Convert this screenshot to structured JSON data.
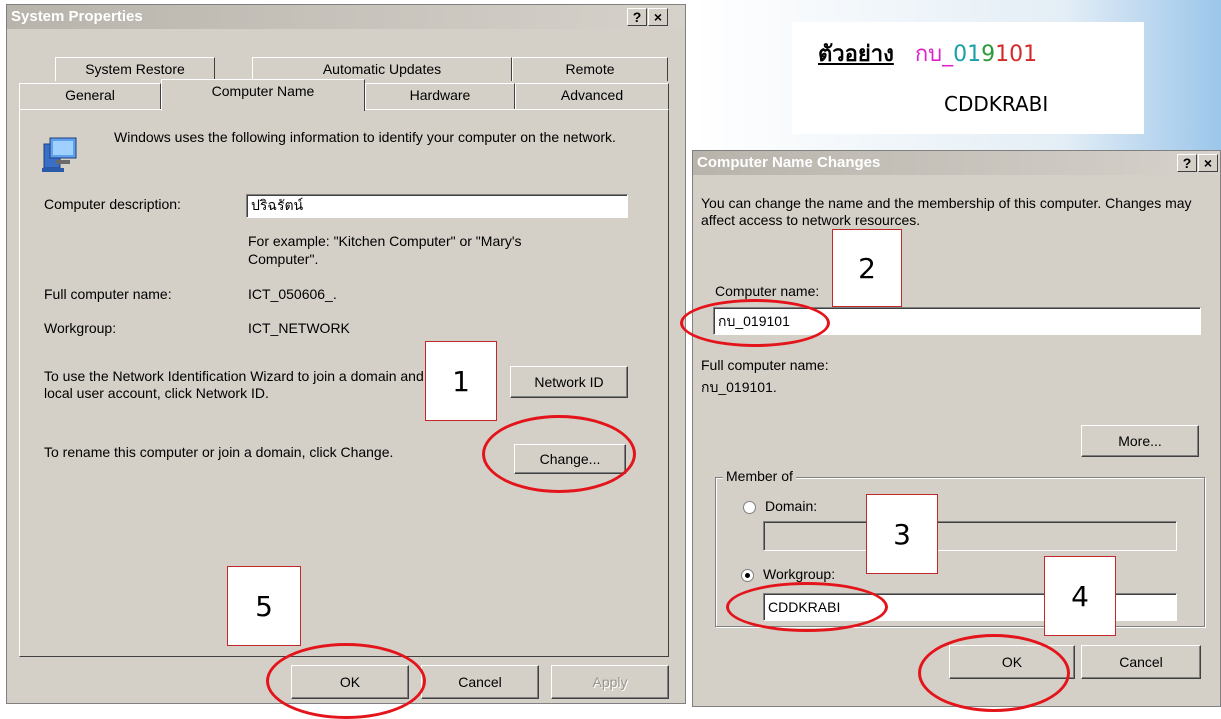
{
  "sys_props": {
    "title": "System Properties",
    "help_btn": "?",
    "close_btn": "×",
    "tabs_top": [
      "System Restore",
      "Automatic Updates",
      "Remote"
    ],
    "tabs_bottom": [
      "General",
      "Computer Name",
      "Hardware",
      "Advanced"
    ],
    "intro": "Windows uses the following information to identify your computer on the network.",
    "desc_label": "Computer description:",
    "desc_value": "ปริฉรัตน์",
    "example": "For example: \"Kitchen Computer\" or \"Mary's Computer\".",
    "full_name_label": "Full computer name:",
    "full_name_value": "ICT_050606_.",
    "workgroup_label": "Workgroup:",
    "workgroup_value": "ICT_NETWORK",
    "wizard_text": "To use the Network Identification Wizard to join a domain and create a local user account, click Network ID.",
    "network_id_btn": "Network ID",
    "rename_text": "To rename this computer or join a domain, click Change.",
    "change_btn": "Change...",
    "ok_btn": "OK",
    "cancel_btn": "Cancel",
    "apply_btn": "Apply"
  },
  "example_box": {
    "label": "ตัวอย่าง",
    "code_prefix": "กบ_",
    "code_d1": "0",
    "code_d2": "1",
    "code_d3": "9",
    "code_d4": "1",
    "code_d5": "0",
    "code_d6": "1",
    "workgroup": "CDDKRABI"
  },
  "name_changes": {
    "title": "Computer Name Changes",
    "help_btn": "?",
    "close_btn": "×",
    "intro": "You can change the name and the membership of this computer. Changes may affect access to network resources.",
    "computer_name_label": "Computer name:",
    "computer_name_value": "กบ_019101",
    "full_name_label": "Full computer name:",
    "full_name_value": "กบ_019101.",
    "more_btn": "More...",
    "member_of": "Member of",
    "domain_label": "Domain:",
    "workgroup_label": "Workgroup:",
    "workgroup_value": "CDDKRABI",
    "ok_btn": "OK",
    "cancel_btn": "Cancel"
  },
  "steps": [
    "1",
    "2",
    "3",
    "4",
    "5"
  ],
  "colors": {
    "ring": "#e4141b",
    "box_border": "#c0282a",
    "example_magenta": "#e020c8",
    "example_teal": "#1aa0a8",
    "example_red": "#d42a2a",
    "example_green": "#2a9a3a"
  }
}
